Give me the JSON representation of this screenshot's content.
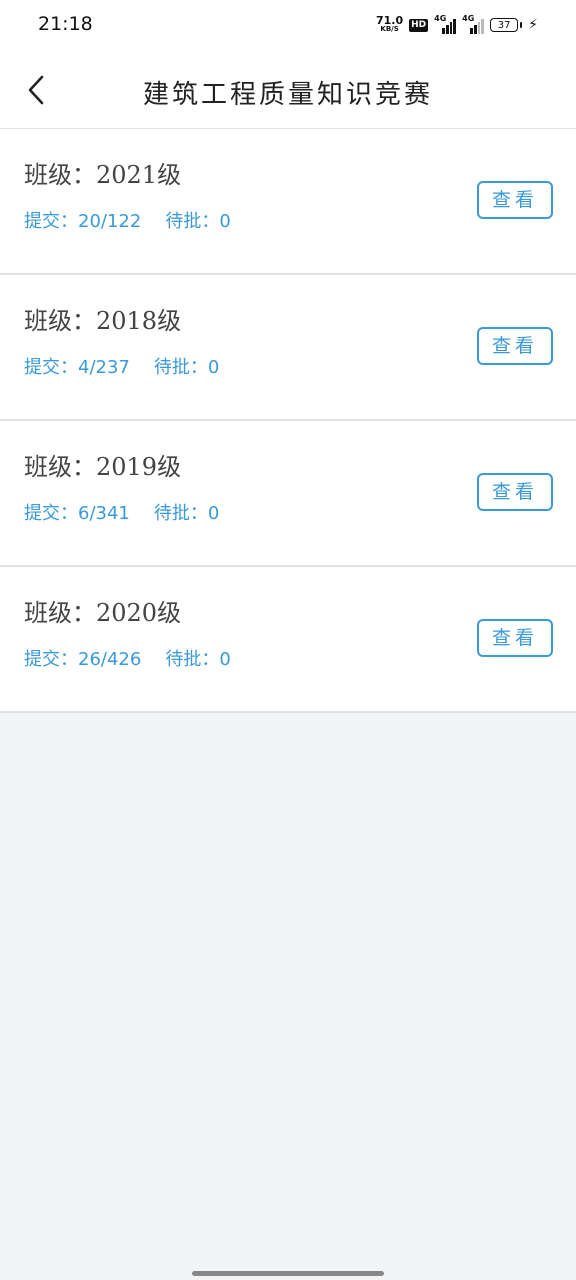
{
  "status_bar": {
    "time": "21:18",
    "net_speed_value": "71.0",
    "net_speed_unit": "KB/S",
    "hd": "HD",
    "signal1_label": "4G",
    "signal2_label": "4G",
    "battery": "37"
  },
  "header": {
    "title": "建筑工程质量知识竞赛"
  },
  "items": [
    {
      "class_label": "班级：",
      "class_value": "2021级",
      "submit_label": "提交：",
      "submit_value": "20/122",
      "pending_label": "待批：",
      "pending_value": "0",
      "button": "查看"
    },
    {
      "class_label": "班级：",
      "class_value": "2018级",
      "submit_label": "提交：",
      "submit_value": "4/237",
      "pending_label": "待批：",
      "pending_value": "0",
      "button": "查看"
    },
    {
      "class_label": "班级：",
      "class_value": "2019级",
      "submit_label": "提交：",
      "submit_value": "6/341",
      "pending_label": "待批：",
      "pending_value": "0",
      "button": "查看"
    },
    {
      "class_label": "班级：",
      "class_value": "2020级",
      "submit_label": "提交：",
      "submit_value": "26/426",
      "pending_label": "待批：",
      "pending_value": "0",
      "button": "查看"
    }
  ],
  "colors": {
    "accent": "#3a9ad9",
    "background": "#f3f4f6"
  }
}
